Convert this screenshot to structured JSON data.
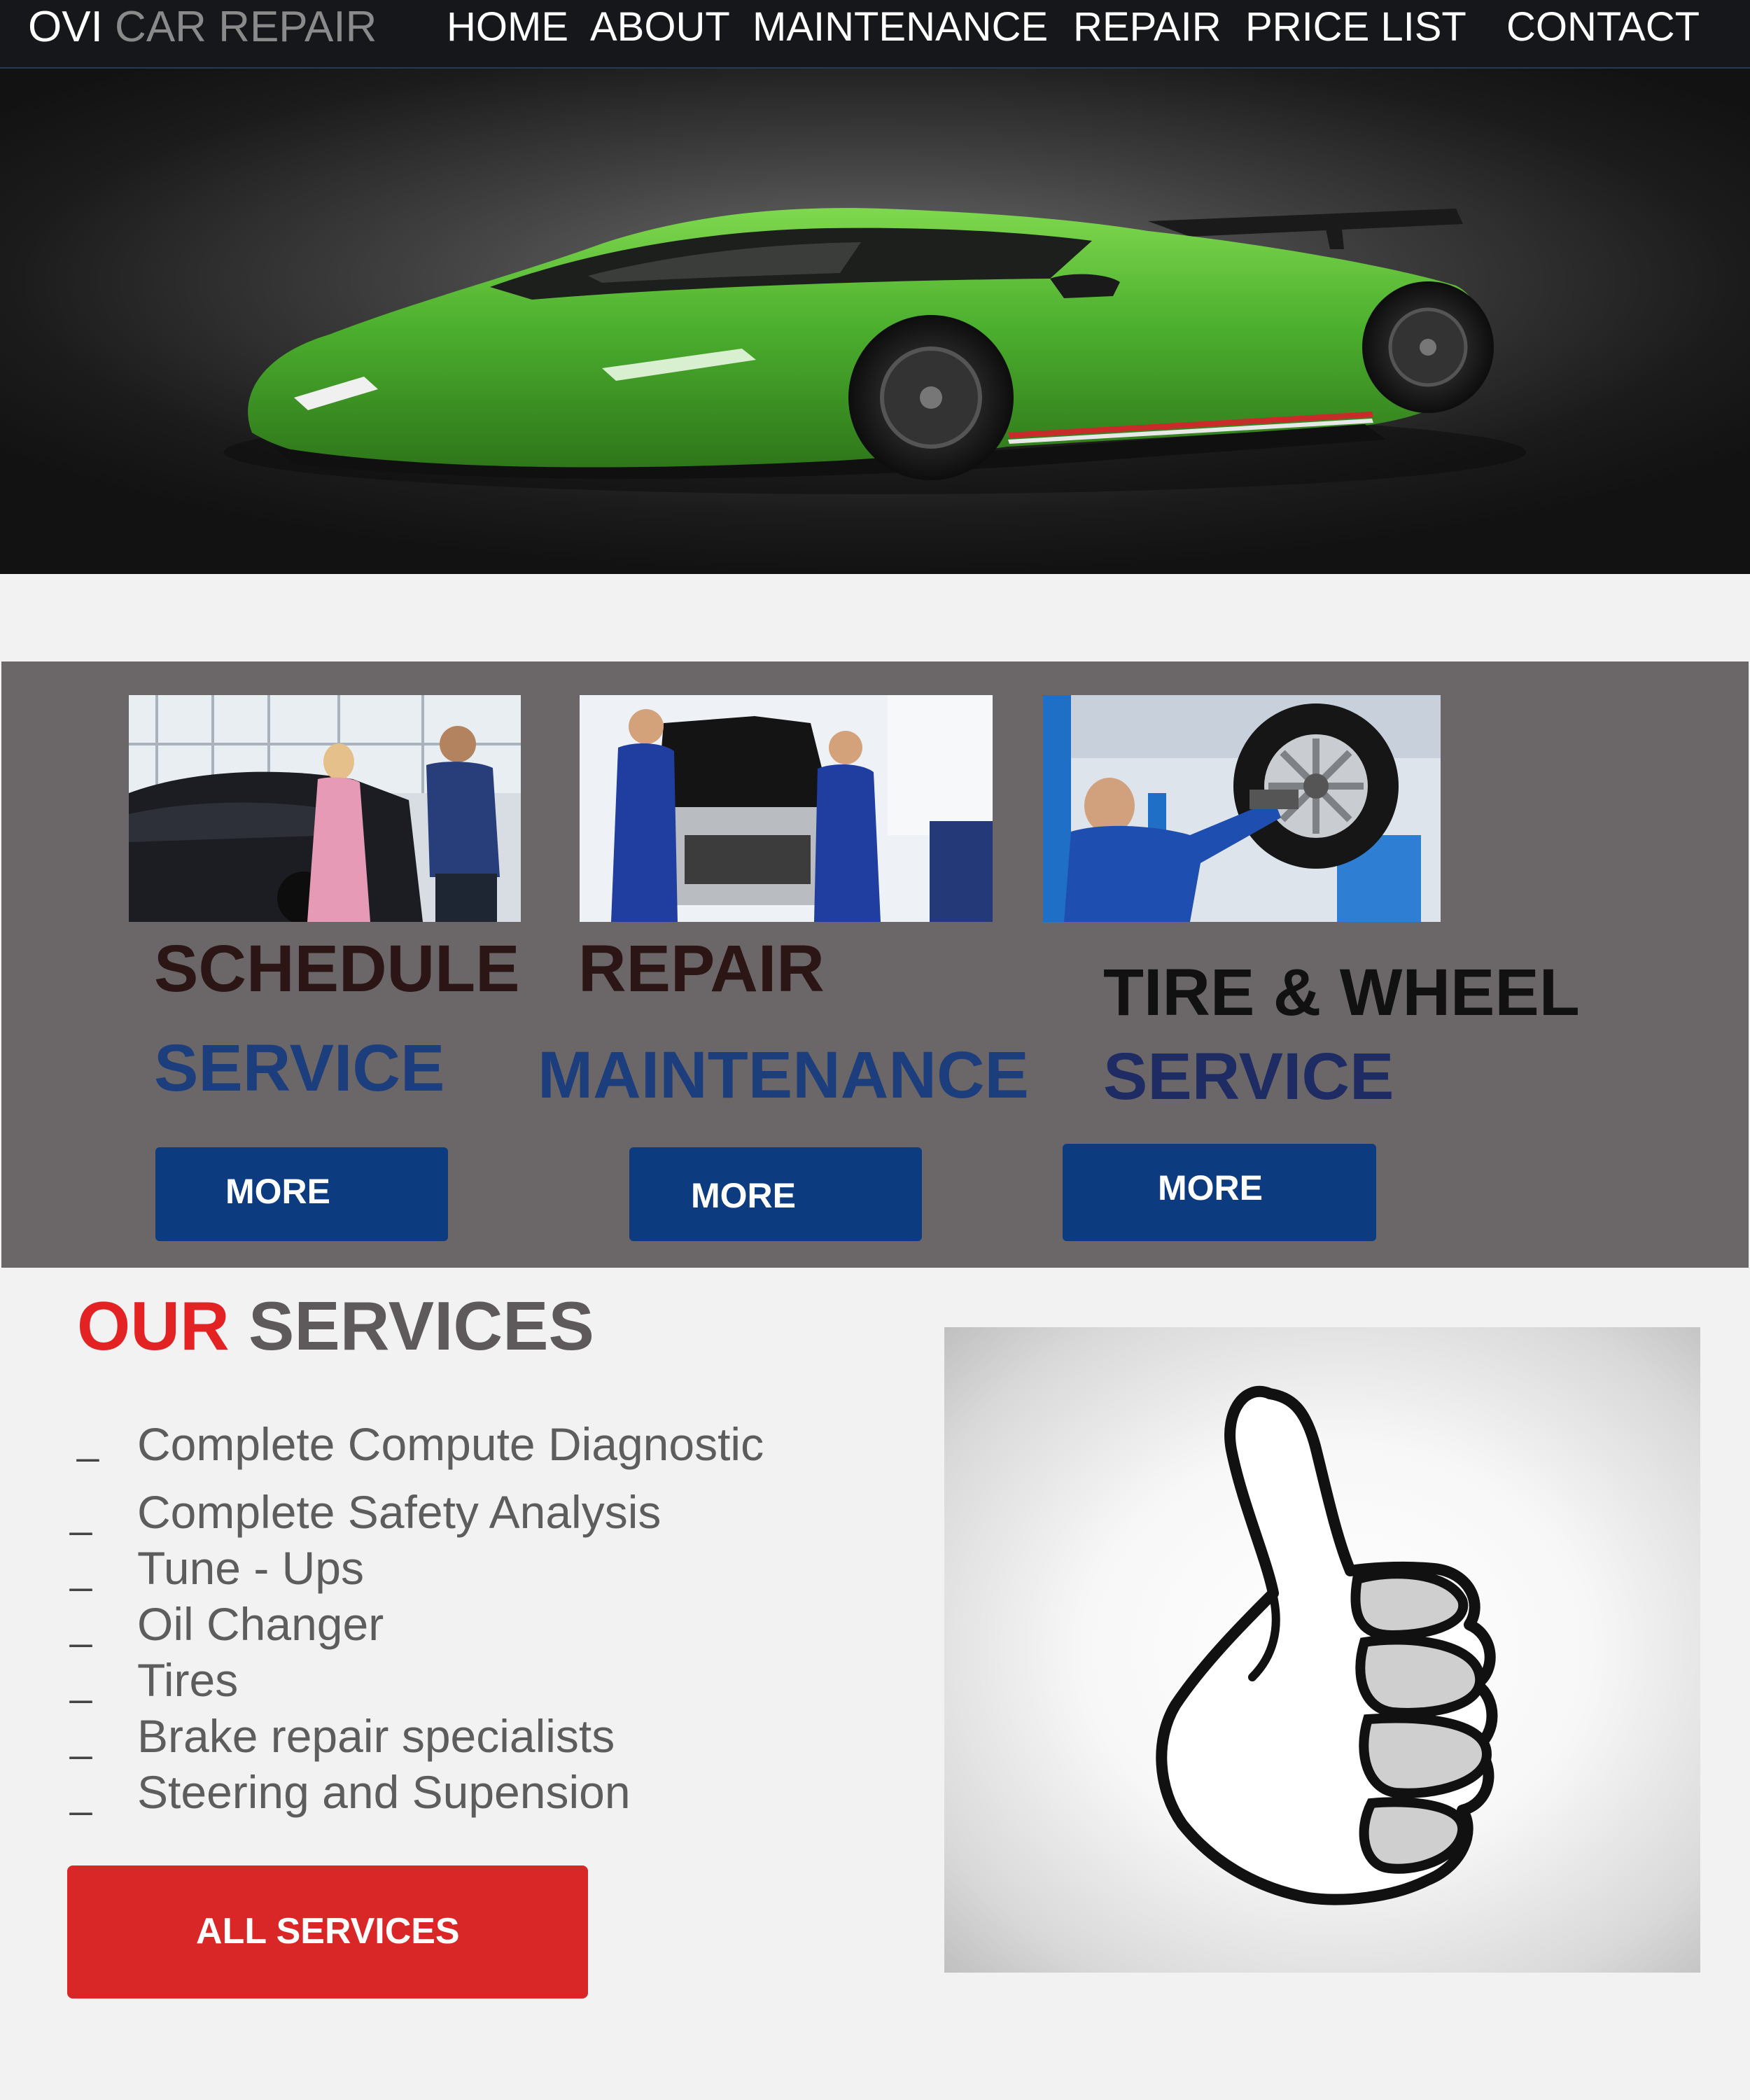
{
  "header": {
    "logo_part1": "OVI",
    "logo_part2": "CAR REPAIR",
    "nav": [
      "HOME",
      "ABOUT",
      "MAINTENANCE",
      "REPAIR",
      "PRICE LIST",
      "CONTACT"
    ]
  },
  "features": [
    {
      "title_line1": "SCHEDULE",
      "title_line2": "SERVICE",
      "button": "MORE"
    },
    {
      "title_line1": "REPAIR",
      "title_line2": "MAINTENANCE",
      "button": "MORE"
    },
    {
      "title_line1": "TIRE & WHEEL",
      "title_line2": "SERVICE",
      "button": "MORE"
    }
  ],
  "services": {
    "title_part1": "OUR",
    "title_part2": "SERVICES",
    "bullet": "_",
    "items": [
      "Complete Compute Diagnostic",
      "Complete Safety Analysis",
      "Tune - Ups",
      "Oil Changer",
      "Tires",
      "Brake repair specialists",
      "Steering and Supension"
    ],
    "button": "ALL SERVICES"
  },
  "colors": {
    "accent_red": "#e32323",
    "button_blue": "#0c3b80",
    "panel_gray": "#6b6768",
    "title_blue": "#1d3e7c",
    "car_green": "#4caf2e"
  },
  "icons": {
    "hero": "green-sports-car",
    "thumb": "thumbs-up-icon"
  }
}
